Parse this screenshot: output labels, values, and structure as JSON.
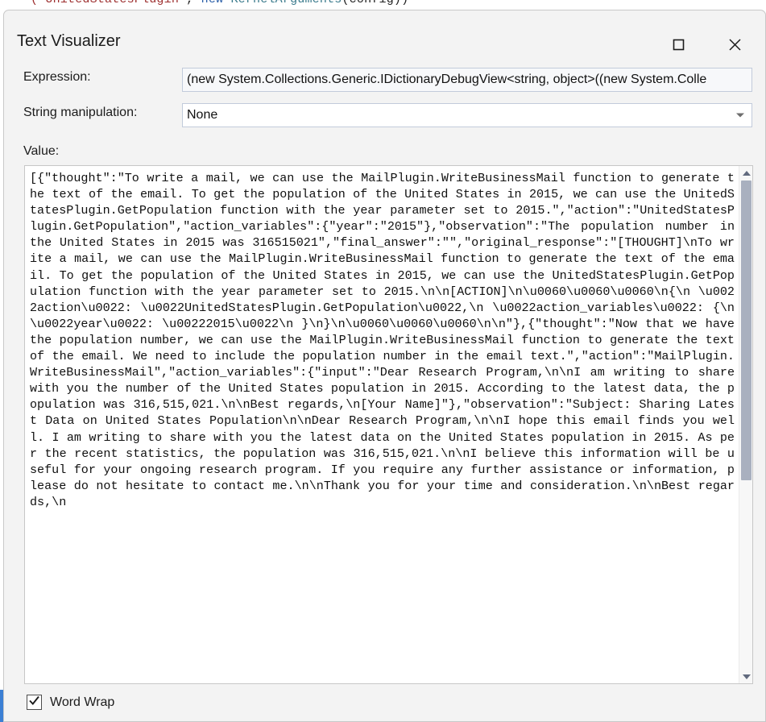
{
  "background": {
    "code_fragment": "(\"UnitedStatesPlugin\", new KernelArguments(config))"
  },
  "window": {
    "title": "Text Visualizer",
    "maximize_tooltip": "Maximize",
    "close_tooltip": "Close"
  },
  "form": {
    "expression": {
      "label": "Expression:",
      "value": "(new System.Collections.Generic.IDictionaryDebugView<string, object>((new System.Colle",
      "placeholder": ""
    },
    "manipulation": {
      "label": "String manipulation:",
      "value": "None",
      "options": [
        "None"
      ]
    }
  },
  "value_section": {
    "label": "Value:",
    "text": "[{\"thought\":\"To write a mail, we can use the MailPlugin.WriteBusinessMail function to generate the text of the email. To get the population of the United States in 2015, we can use the UnitedStatesPlugin.GetPopulation function with the year parameter set to 2015.\",\"action\":\"UnitedStatesPlugin.GetPopulation\",\"action_variables\":{\"year\":\"2015\"},\"observation\":\"The population number in the United States in 2015 was 316515021\",\"final_answer\":\"\",\"original_response\":\"[THOUGHT]\\nTo write a mail, we can use the MailPlugin.WriteBusinessMail function to generate the text of the email. To get the population of the United States in 2015, we can use the UnitedStatesPlugin.GetPopulation function with the year parameter set to 2015.\\n\\n[ACTION]\\n\\u0060\\u0060\\u0060\\n{\\n \\u0022action\\u0022: \\u0022UnitedStatesPlugin.GetPopulation\\u0022,\\n \\u0022action_variables\\u0022: {\\n \\u0022year\\u0022: \\u00222015\\u0022\\n }\\n}\\n\\u0060\\u0060\\u0060\\n\\n\"},{\"thought\":\"Now that we have the population number, we can use the MailPlugin.WriteBusinessMail function to generate the text of the email. We need to include the population number in the email text.\",\"action\":\"MailPlugin.WriteBusinessMail\",\"action_variables\":{\"input\":\"Dear Research Program,\\n\\nI am writing to share with you the number of the United States population in 2015. According to the latest data, the population was 316,515,021.\\n\\nBest regards,\\n[Your Name]\"},\"observation\":\"Subject: Sharing Latest Data on United States Population\\n\\nDear Research Program,\\n\\nI hope this email finds you well. I am writing to share with you the latest data on the United States population in 2015. As per the recent statistics, the population was 316,515,021.\\n\\nI believe this information will be useful for your ongoing research program. If you require any further assistance or information, please do not hesitate to contact me.\\n\\nThank you for your time and consideration.\\n\\nBest regards,\\n"
  },
  "footer": {
    "word_wrap_label": "Word Wrap",
    "word_wrap_checked": true
  },
  "colors": {
    "dialog_background": "#f3f3f3",
    "field_border": "#c2cbdb",
    "scrollbar_thumb": "#a9b0bf",
    "text": "#1b1b1b",
    "accent": "#3b7fd4"
  },
  "scrollbar": {
    "up_arrow": "scroll-up-icon",
    "down_arrow": "scroll-down-icon"
  }
}
